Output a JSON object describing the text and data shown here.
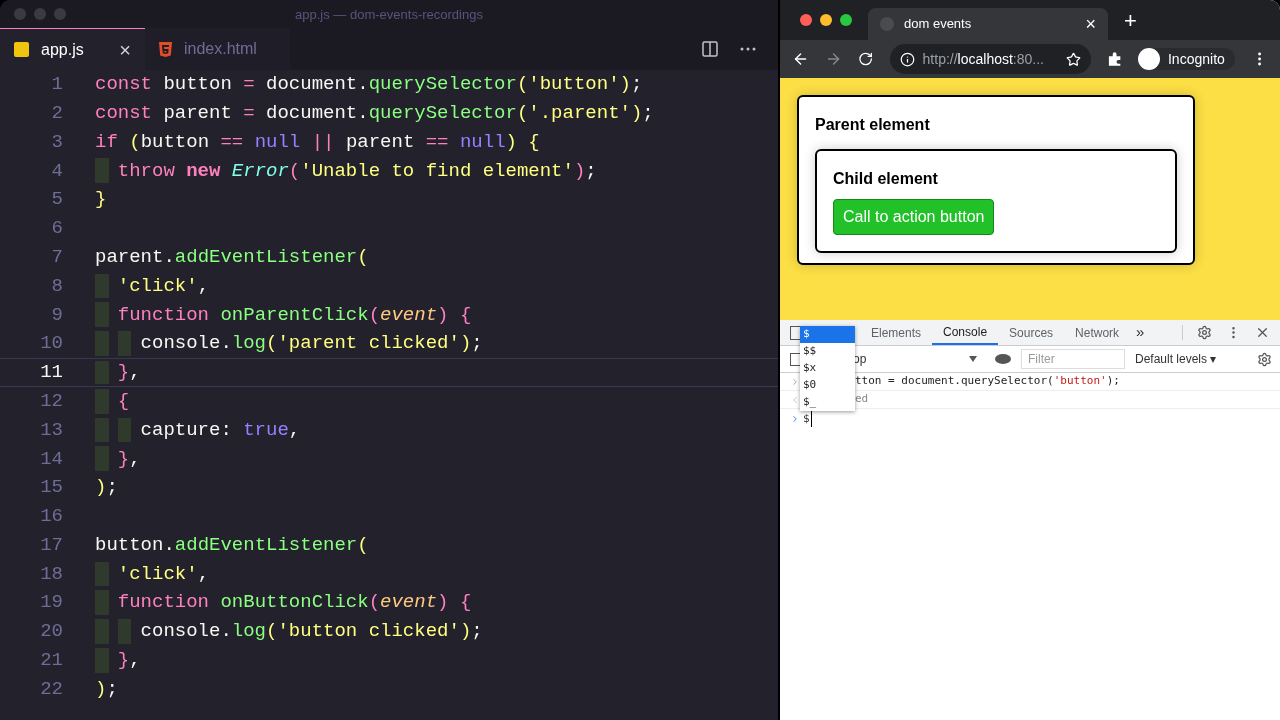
{
  "editor": {
    "window_title": "app.js — dom-events-recordings",
    "tabs": [
      {
        "label": "app.js",
        "kind": "js",
        "selected": true,
        "close": "×"
      },
      {
        "label": "index.html",
        "kind": "html",
        "selected": false
      }
    ],
    "lines": [
      {
        "number": "1",
        "current": false,
        "tokens": [
          {
            "kind": "keyword",
            "text": "const"
          },
          {
            "kind": "plain",
            "text": " button "
          },
          {
            "kind": "keyword",
            "text": "="
          },
          {
            "kind": "plain",
            "text": " document."
          },
          {
            "kind": "function",
            "text": "querySelector"
          },
          {
            "kind": "bracket1",
            "text": "("
          },
          {
            "kind": "string",
            "text": "'button'"
          },
          {
            "kind": "bracket1",
            "text": ")"
          },
          {
            "kind": "plain",
            "text": ";"
          }
        ]
      },
      {
        "number": "2",
        "current": false,
        "tokens": [
          {
            "kind": "keyword",
            "text": "const"
          },
          {
            "kind": "plain",
            "text": " parent "
          },
          {
            "kind": "keyword",
            "text": "="
          },
          {
            "kind": "plain",
            "text": " document."
          },
          {
            "kind": "function",
            "text": "querySelector"
          },
          {
            "kind": "bracket1",
            "text": "("
          },
          {
            "kind": "string",
            "text": "'.parent'"
          },
          {
            "kind": "bracket1",
            "text": ")"
          },
          {
            "kind": "plain",
            "text": ";"
          }
        ]
      },
      {
        "number": "3",
        "current": false,
        "tokens": [
          {
            "kind": "keyword",
            "text": "if"
          },
          {
            "kind": "bracket1",
            "text": " ("
          },
          {
            "kind": "plain",
            "text": "button "
          },
          {
            "kind": "keyword",
            "text": "=="
          },
          {
            "kind": "literal",
            "text": " null "
          },
          {
            "kind": "keyword",
            "text": "||"
          },
          {
            "kind": "plain",
            "text": " parent "
          },
          {
            "kind": "keyword",
            "text": "=="
          },
          {
            "kind": "literal",
            "text": " null"
          },
          {
            "kind": "bracket1",
            "text": ") {"
          }
        ]
      },
      {
        "number": "4",
        "current": false,
        "tokens": [
          {
            "kind": "keyword",
            "text": "  throw "
          },
          {
            "kind": "keyword_bold",
            "text": "new "
          },
          {
            "kind": "class",
            "text": "Error"
          },
          {
            "kind": "bracket2",
            "text": "("
          },
          {
            "kind": "string",
            "text": "'Unable to find element'"
          },
          {
            "kind": "bracket2",
            "text": ")"
          },
          {
            "kind": "plain",
            "text": ";"
          }
        ]
      },
      {
        "number": "5",
        "current": false,
        "tokens": [
          {
            "kind": "bracket1",
            "text": "}"
          }
        ]
      },
      {
        "number": "6",
        "current": false
      },
      {
        "number": "7",
        "current": false,
        "tokens": [
          {
            "kind": "plain",
            "text": "parent."
          },
          {
            "kind": "function",
            "text": "addEventListener"
          },
          {
            "kind": "bracket1",
            "text": "("
          }
        ]
      },
      {
        "number": "8",
        "current": false,
        "tokens": [
          {
            "kind": "string",
            "text": "  'click'"
          },
          {
            "kind": "plain",
            "text": ","
          }
        ]
      },
      {
        "number": "9",
        "current": false,
        "tokens": [
          {
            "kind": "keyword",
            "text": "  function "
          },
          {
            "kind": "function",
            "text": "onParentClick"
          },
          {
            "kind": "bracket2",
            "text": "("
          },
          {
            "kind": "param",
            "text": "event"
          },
          {
            "kind": "bracket2",
            "text": ") {"
          }
        ]
      },
      {
        "number": "10",
        "current": false,
        "tokens": [
          {
            "kind": "plain",
            "text": "    console."
          },
          {
            "kind": "function",
            "text": "log"
          },
          {
            "kind": "bracket1",
            "text": "("
          },
          {
            "kind": "string",
            "text": "'parent clicked'"
          },
          {
            "kind": "bracket1",
            "text": ")"
          },
          {
            "kind": "plain",
            "text": ";"
          }
        ]
      },
      {
        "number": "11",
        "current": true,
        "tokens": [
          {
            "kind": "bracket2",
            "text": "  }"
          },
          {
            "kind": "plain",
            "text": ","
          }
        ]
      },
      {
        "number": "12",
        "current": false,
        "tokens": [
          {
            "kind": "bracket2",
            "text": "  {"
          }
        ]
      },
      {
        "number": "13",
        "current": false,
        "tokens": [
          {
            "kind": "plain",
            "text": "    capture: "
          },
          {
            "kind": "literal",
            "text": "true"
          },
          {
            "kind": "plain",
            "text": ","
          }
        ]
      },
      {
        "number": "14",
        "current": false,
        "tokens": [
          {
            "kind": "bracket2",
            "text": "  }"
          },
          {
            "kind": "plain",
            "text": ","
          }
        ]
      },
      {
        "number": "15",
        "current": false,
        "tokens": [
          {
            "kind": "bracket1",
            "text": ")"
          },
          {
            "kind": "plain",
            "text": ";"
          }
        ]
      },
      {
        "number": "16",
        "current": false
      },
      {
        "number": "17",
        "current": false,
        "tokens": [
          {
            "kind": "plain",
            "text": "button."
          },
          {
            "kind": "function",
            "text": "addEventListener"
          },
          {
            "kind": "bracket1",
            "text": "("
          }
        ]
      },
      {
        "number": "18",
        "current": false,
        "tokens": [
          {
            "kind": "string",
            "text": "  'click'"
          },
          {
            "kind": "plain",
            "text": ","
          }
        ]
      },
      {
        "number": "19",
        "current": false,
        "tokens": [
          {
            "kind": "keyword",
            "text": "  function "
          },
          {
            "kind": "function",
            "text": "onButtonClick"
          },
          {
            "kind": "bracket2",
            "text": "("
          },
          {
            "kind": "param",
            "text": "event"
          },
          {
            "kind": "bracket2",
            "text": ") {"
          }
        ]
      },
      {
        "number": "20",
        "current": false,
        "tokens": [
          {
            "kind": "plain",
            "text": "    console."
          },
          {
            "kind": "function",
            "text": "log"
          },
          {
            "kind": "bracket1",
            "text": "("
          },
          {
            "kind": "string",
            "text": "'button clicked'"
          },
          {
            "kind": "bracket1",
            "text": ")"
          },
          {
            "kind": "plain",
            "text": ";"
          }
        ]
      },
      {
        "number": "21",
        "current": false,
        "tokens": [
          {
            "kind": "bracket2",
            "text": "  }"
          },
          {
            "kind": "plain",
            "text": ","
          }
        ]
      },
      {
        "number": "22",
        "current": false,
        "tokens": [
          {
            "kind": "bracket1",
            "text": ")"
          },
          {
            "kind": "plain",
            "text": ";"
          }
        ]
      }
    ]
  },
  "browser": {
    "tab_title": "dom events",
    "tab_close": "×",
    "new_tab": "+",
    "url_scheme": "http://",
    "url_host": "localhost",
    "url_rest": ":80...",
    "profile": "Incognito",
    "page": {
      "parent_title": "Parent element",
      "child_title": "Child element",
      "button": "Call to action button"
    },
    "devtools": {
      "tabs": [
        {
          "label": "Elements",
          "selected": false
        },
        {
          "label": "Console",
          "selected": true
        },
        {
          "label": "Sources",
          "selected": false
        },
        {
          "label": "Network",
          "selected": false
        }
      ],
      "more": "»",
      "context": "op",
      "filter_placeholder": "Filter",
      "levels": "Default levels ▾",
      "console": [
        {
          "kind": "input",
          "tokens": [
            {
              "kind": "plain",
              "text": "tton = document.querySelector("
            },
            {
              "kind": "string",
              "text": "'button'"
            },
            {
              "kind": "plain",
              "text": ");"
            }
          ]
        },
        {
          "kind": "output",
          "tokens": [
            {
              "kind": "plain",
              "text": "ed"
            }
          ]
        }
      ],
      "prompt": "$",
      "autocomplete": [
        {
          "label": "$",
          "selected": true
        },
        {
          "label": "$$",
          "selected": false
        },
        {
          "label": "$x",
          "selected": false
        },
        {
          "label": "$0",
          "selected": false
        },
        {
          "label": "$_",
          "selected": false
        }
      ]
    }
  }
}
